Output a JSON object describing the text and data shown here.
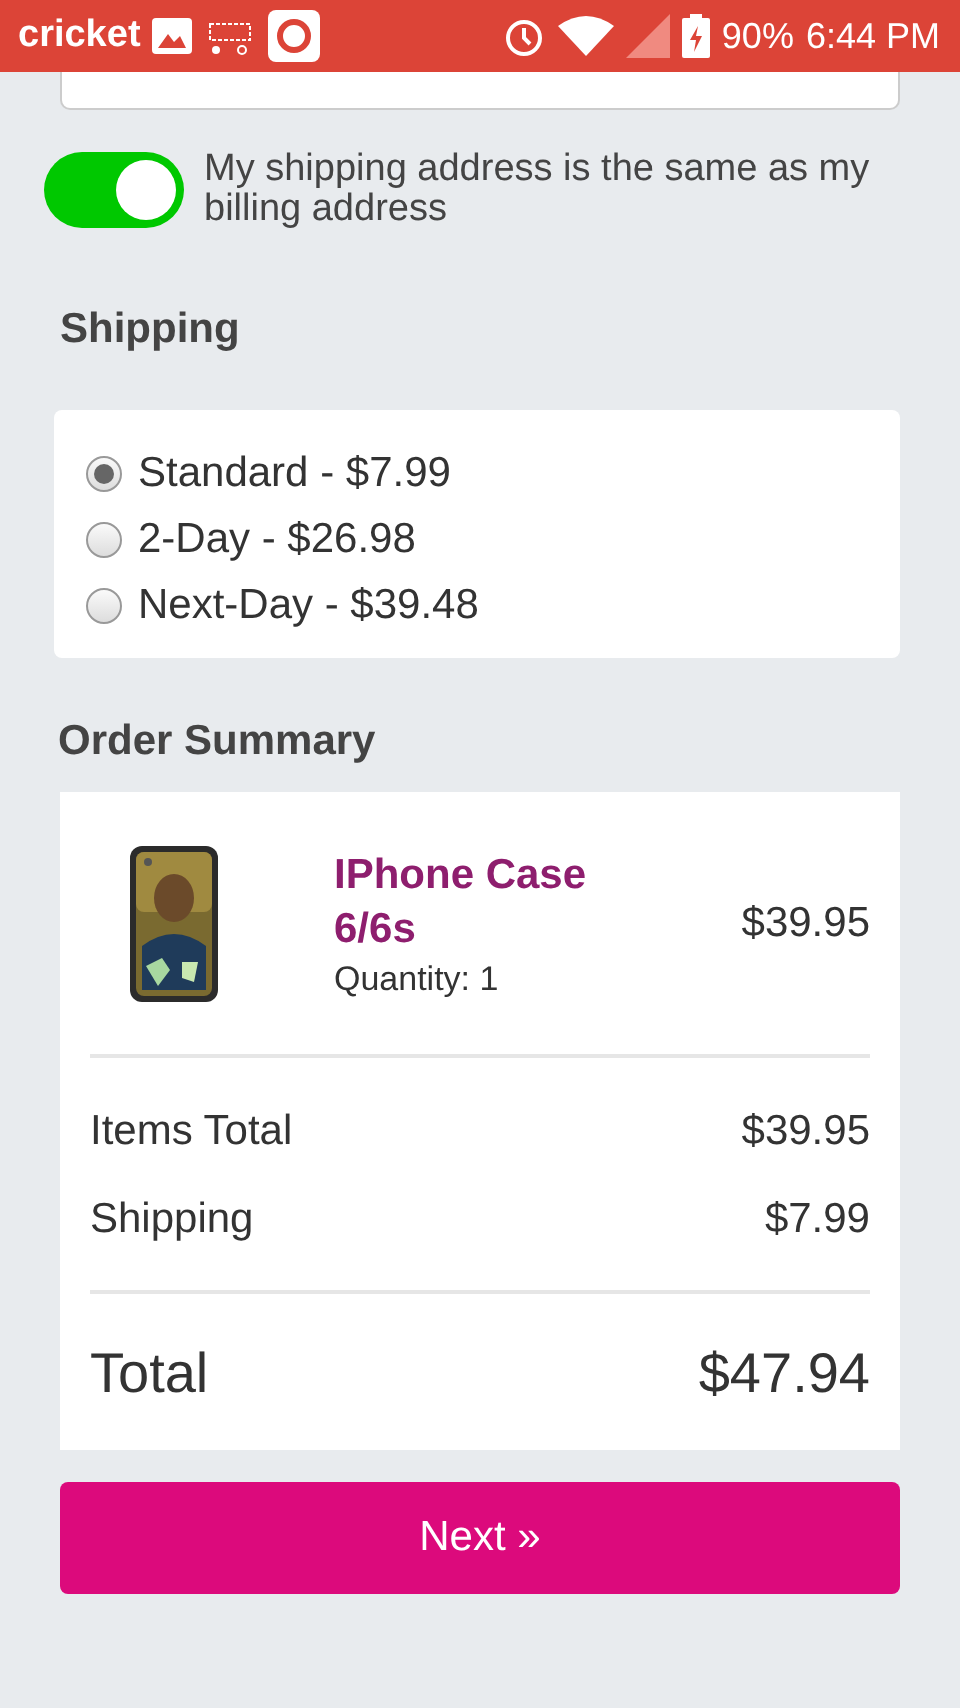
{
  "status_bar": {
    "carrier": "cricket",
    "battery": "90%",
    "time": "6:44 PM"
  },
  "same_address_toggle": {
    "label": "My shipping address is the same as my billing address",
    "on": true
  },
  "shipping": {
    "title": "Shipping",
    "options": [
      {
        "label": "Standard - $7.99",
        "selected": true
      },
      {
        "label": "2-Day - $26.98",
        "selected": false
      },
      {
        "label": "Next-Day - $39.48",
        "selected": false
      }
    ]
  },
  "order_summary": {
    "title": "Order Summary",
    "items": [
      {
        "kind": "picture",
        "name": "IPhone Case 6/6s",
        "quantity": "Quantity: 1",
        "price": "$39.95"
      }
    ],
    "lines": [
      {
        "label": "Items Total",
        "value": "$39.95"
      },
      {
        "label": "Shipping",
        "value": "$7.99"
      }
    ],
    "total": {
      "label": "Total",
      "value": "$47.94"
    }
  },
  "next_button": "Next »"
}
